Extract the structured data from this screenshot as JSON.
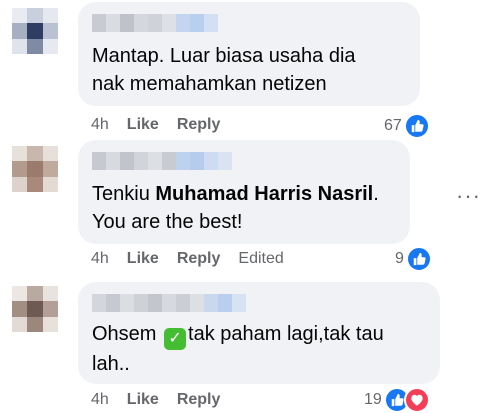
{
  "comments": [
    {
      "text": "Mantap. Luar biasa usaha dia nak memahamkan netizen",
      "time": "4h",
      "like": "Like",
      "reply": "Reply",
      "reactions": "67"
    },
    {
      "text_before": "Tenkiu ",
      "mention": "Muhamad Harris Nasril",
      "text_after": ". You are the best!",
      "time": "4h",
      "like": "Like",
      "reply": "Reply",
      "edited": "Edited",
      "reactions": "9"
    },
    {
      "text_before": "Ohsem ",
      "text_after": "tak paham lagi,tak tau lah..",
      "time": "4h",
      "like": "Like",
      "reply": "Reply",
      "reactions": "19"
    }
  ],
  "more_menu": "···",
  "icons": {
    "like": "like-icon",
    "love": "love-icon",
    "check": "check-mark-emoji",
    "more": "more-options-icon"
  },
  "colors": {
    "bubble": "#f0f2f5",
    "like_blue": "#1877f2",
    "love_red": "#f33e58",
    "meta_gray": "#65676b",
    "check_green": "#44bd32"
  }
}
